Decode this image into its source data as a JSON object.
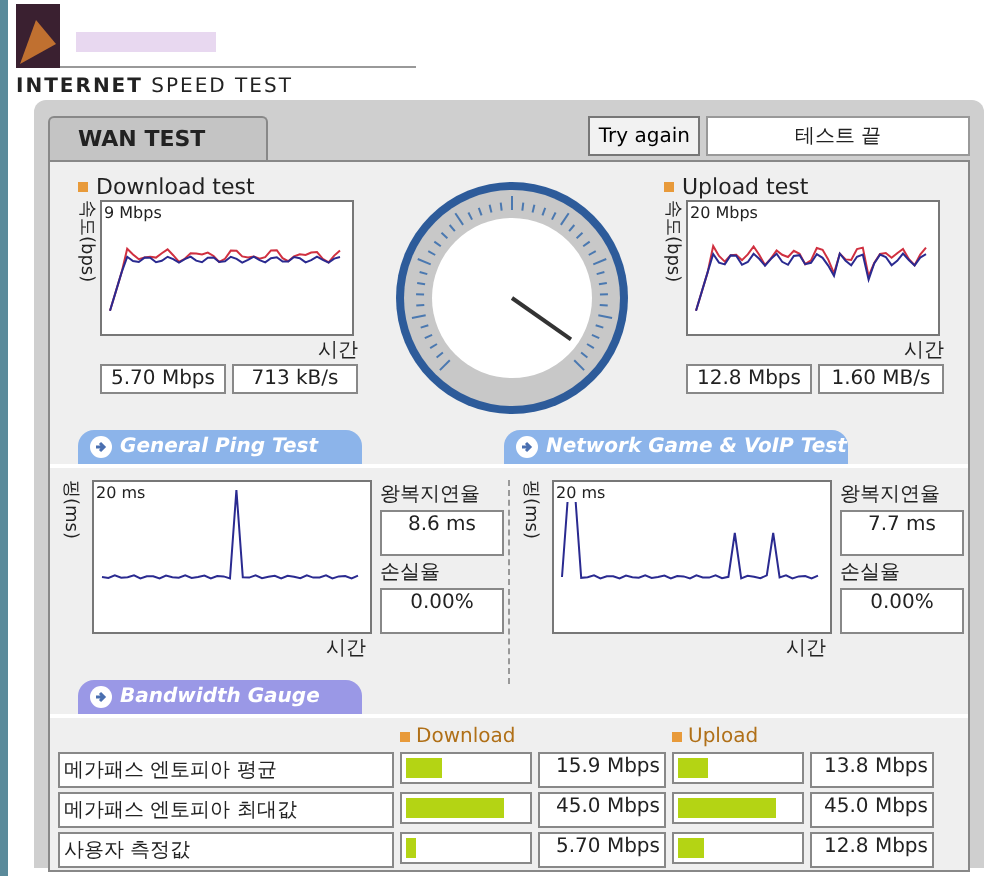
{
  "header": {
    "title": "**INTERNET** SPEED TEST"
  },
  "tabs": [
    {
      "label": "WAN TEST",
      "selected": true
    }
  ],
  "try_again": "Try again",
  "status": "테스트 끝",
  "speed_tests": [
    {
      "title": "Download test",
      "y_label": "속도(bps)",
      "scale": "9 Mbps",
      "x_label": "시간",
      "readings": [
        "5.70 Mbps",
        "713 kB/s"
      ]
    },
    {
      "title": "Upload test",
      "y_label": "속도(bps)",
      "scale": "20 Mbps",
      "x_label": "시간",
      "readings": [
        "12.8 Mbps",
        "1.60 MB/s"
      ]
    }
  ],
  "ping_tests": [
    {
      "tab": "General Ping Test",
      "y_label": "핑(ms)",
      "scale": "20 ms",
      "x_label": "시간",
      "rtt_label": "왕복지연율",
      "rtt": "8.6 ms",
      "loss_label": "손실율",
      "loss": "0.00%"
    },
    {
      "tab": "Network Game & VoIP Test",
      "y_label": "핑(ms)",
      "scale": "20 ms",
      "x_label": "시간",
      "rtt_label": "왕복지연율",
      "rtt": "7.7 ms",
      "loss_label": "손실율",
      "loss": "0.00%"
    }
  ],
  "bandwidth": {
    "tab": "Bandwidth Gauge",
    "columns": [
      "Download",
      "Upload"
    ],
    "rows": [
      {
        "label": "메가패스 엔토피아 평균",
        "download": {
          "level": 0.3,
          "reading": "15.9 Mbps"
        },
        "upload": {
          "level": 0.25,
          "reading": "13.8 Mbps"
        }
      },
      {
        "label": "메가패스 엔토피아 최대값",
        "download": {
          "level": 0.82,
          "reading": "45.0 Mbps"
        },
        "upload": {
          "level": 0.82,
          "reading": "45.0 Mbps"
        }
      },
      {
        "label": "사용자 측정값",
        "download": {
          "level": 0.08,
          "reading": "5.70 Mbps"
        },
        "upload": {
          "level": 0.22,
          "reading": "12.8 Mbps"
        }
      }
    ]
  }
}
